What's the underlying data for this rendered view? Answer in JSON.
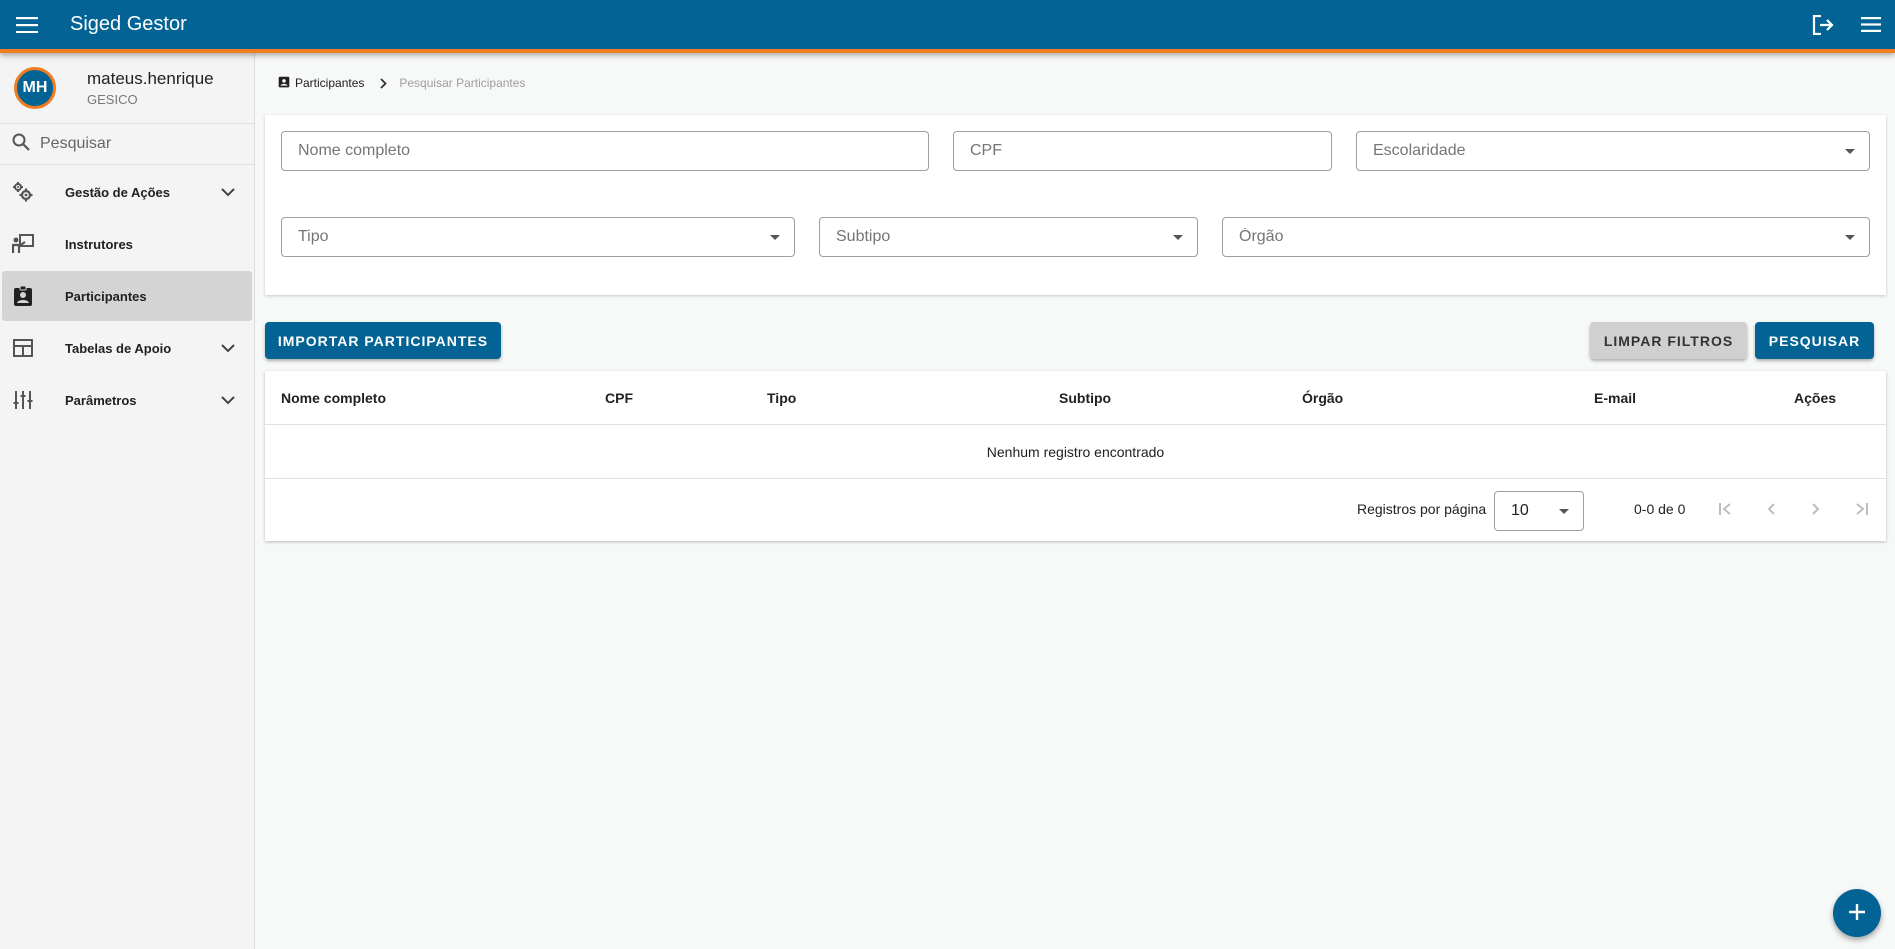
{
  "header": {
    "app_title": "Siged Gestor",
    "menu_icon": "menu-icon",
    "logout_icon": "logout-icon",
    "more_icon": "menu-icon",
    "color": "#036394",
    "accent": "#f07d21"
  },
  "user": {
    "initials": "MH",
    "name": "mateus.henrique",
    "org": "GESICO"
  },
  "sidebar": {
    "search_placeholder": "Pesquisar",
    "items": [
      {
        "label": "Gestão de Ações",
        "icon": "gears-icon",
        "expandable": true
      },
      {
        "label": "Instrutores",
        "icon": "instructor-icon",
        "expandable": false
      },
      {
        "label": "Participantes",
        "icon": "badge-icon",
        "expandable": false,
        "active": true
      },
      {
        "label": "Tabelas de Apoio",
        "icon": "table-icon",
        "expandable": true
      },
      {
        "label": "Parâmetros",
        "icon": "sliders-icon",
        "expandable": true
      }
    ]
  },
  "breadcrumb": {
    "root": "Participantes",
    "current": "Pesquisar Participantes"
  },
  "filters": {
    "nome_placeholder": "Nome completo",
    "cpf_placeholder": "CPF",
    "escolaridade_placeholder": "Escolaridade",
    "tipo_placeholder": "Tipo",
    "subtipo_placeholder": "Subtipo",
    "orgao_placeholder": "Órgão"
  },
  "actions": {
    "import_label": "Importar Participantes",
    "clear_label": "Limpar Filtros",
    "search_label": "Pesquisar"
  },
  "table": {
    "columns": [
      "Nome completo",
      "CPF",
      "Tipo",
      "Subtipo",
      "Órgão",
      "E-mail",
      "Ações"
    ],
    "empty_message": "Nenhum registro encontrado"
  },
  "pagination": {
    "rows_label": "Registros por página",
    "rows_value": "10",
    "range": "0-0 de 0"
  }
}
